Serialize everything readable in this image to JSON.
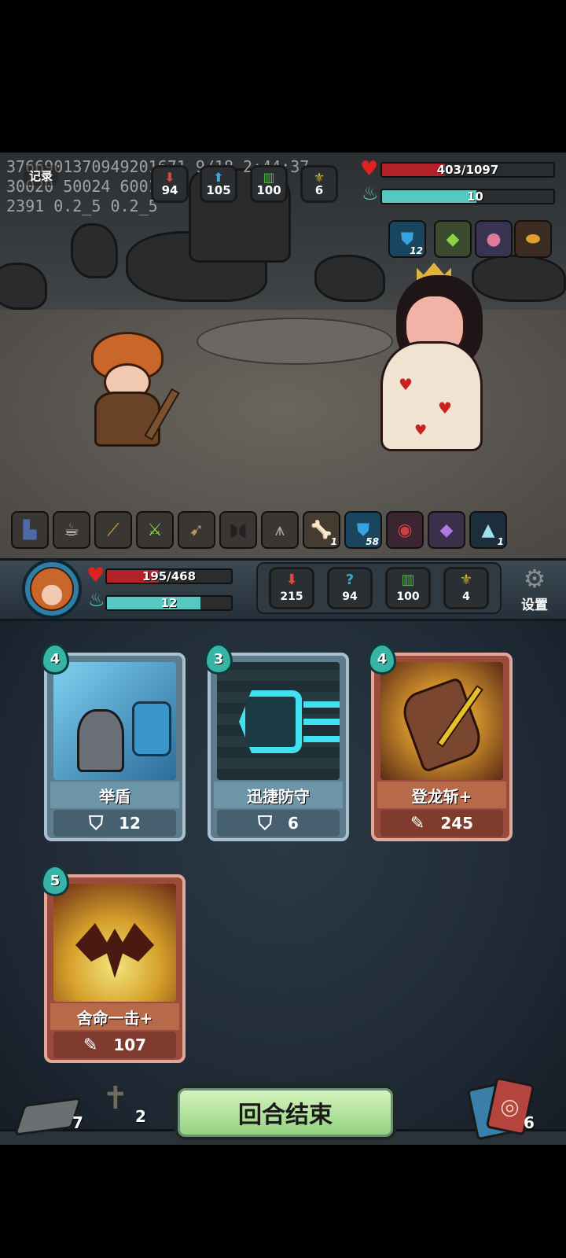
{
  "debug": {
    "line1": "3766901370949201671 9/18 2:44:37",
    "line2": "30020 50024 60013",
    "line3": "2391 0.2_5 0.2_5"
  },
  "record_button": {
    "label": "记录"
  },
  "enemy": {
    "stats": [
      {
        "icon": "attack-icon",
        "value": "94",
        "color": "#b33a2e"
      },
      {
        "icon": "speed-icon",
        "value": "105",
        "color": "#2f6f8e"
      },
      {
        "icon": "defense-icon",
        "value": "100",
        "color": "#3e8a3a"
      },
      {
        "icon": "luck-icon",
        "value": "6",
        "color": "#a8901f"
      }
    ],
    "hp": {
      "text": "403/1097",
      "fraction": 0.367
    },
    "energy": {
      "text": "10",
      "fraction": 0.55
    },
    "buffs": [
      {
        "icon": "shield-buff-icon",
        "count": "12"
      },
      {
        "icon": "green-gem-icon",
        "count": ""
      },
      {
        "icon": "crystal-orb-icon",
        "count": ""
      },
      {
        "icon": "dragon-egg-icon",
        "count": ""
      }
    ]
  },
  "equipment_bar": [
    {
      "icon": "boots-icon",
      "count": ""
    },
    {
      "icon": "teacup-icon",
      "count": ""
    },
    {
      "icon": "baguette-icon",
      "count": ""
    },
    {
      "icon": "poison-dagger-icon",
      "count": ""
    },
    {
      "icon": "crossbow-icon",
      "count": ""
    },
    {
      "icon": "sunglasses-icon",
      "count": ""
    },
    {
      "icon": "spike-trap-icon",
      "count": ""
    },
    {
      "icon": "bone-icon",
      "count": "1"
    },
    {
      "icon": "shield-buff-icon",
      "count": "58"
    },
    {
      "icon": "swirl-orb-icon",
      "count": ""
    },
    {
      "icon": "purple-crystal-icon",
      "count": ""
    },
    {
      "icon": "triforce-icon",
      "count": "1"
    }
  ],
  "player": {
    "hp": {
      "text": "195/468",
      "fraction": 0.417
    },
    "energy": {
      "text": "12",
      "fraction": 0.75
    },
    "stats": [
      {
        "icon": "attack-icon",
        "value": "215",
        "color": "#b33a2e"
      },
      {
        "icon": "mystery-icon",
        "value": "94",
        "color": "#2f6f8e"
      },
      {
        "icon": "defense-icon",
        "value": "100",
        "color": "#3e8a3a"
      },
      {
        "icon": "luck-icon",
        "value": "4",
        "color": "#a8901f"
      }
    ],
    "settings_label": "设置"
  },
  "hand": [
    {
      "cost": "4",
      "name": "举盾",
      "value": "12",
      "type": "block",
      "style": "blue"
    },
    {
      "cost": "3",
      "name": "迅捷防守",
      "value": "6",
      "type": "block",
      "style": "blue"
    },
    {
      "cost": "4",
      "name": "登龙斩+",
      "value": "245",
      "type": "attack",
      "style": "red"
    },
    {
      "cost": "5",
      "name": "舍命一击+",
      "value": "107",
      "type": "attack",
      "style": "red"
    }
  ],
  "bottom": {
    "draw_pile": "7",
    "discard_pile": "2",
    "end_turn": "回合结束",
    "exhaust_pile": "6"
  }
}
